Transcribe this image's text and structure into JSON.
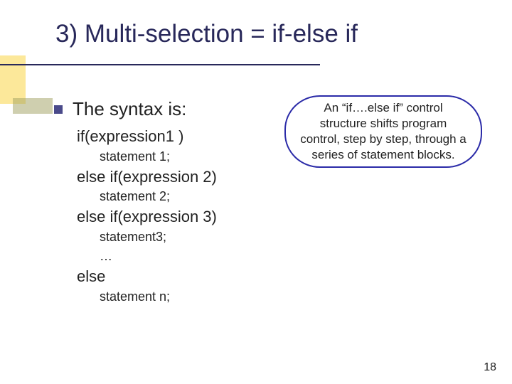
{
  "title": "3) Multi-selection = if-else if",
  "bullet": "The syntax is:",
  "syntax": {
    "line1": "if(expression1 )",
    "stmt1": "statement 1;",
    "line2": "else if(expression 2)",
    "stmt2": "statement 2;",
    "line3": "else if(expression 3)",
    "stmt3": "statement3;",
    "dots": "…",
    "line4": "else",
    "stmt4": "statement n;"
  },
  "callout": "An “if….else if” control structure shifts program control, step by step, through a series of statement blocks.",
  "page_number": "18"
}
